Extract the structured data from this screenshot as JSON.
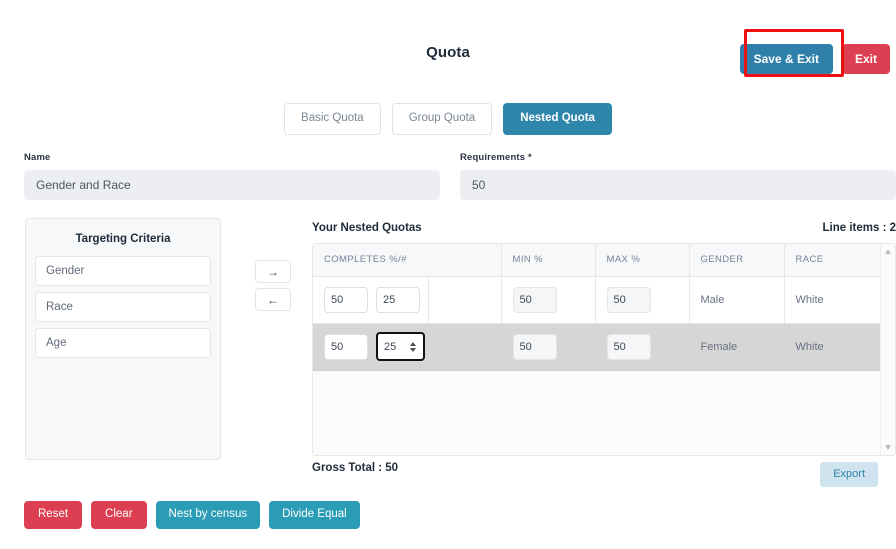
{
  "header": {
    "title": "Quota",
    "save_exit_label": "Save & Exit",
    "exit_label": "Exit",
    "annotation_color": "#ee1111"
  },
  "tabs": [
    {
      "label": "Basic Quota",
      "active": false
    },
    {
      "label": "Group Quota",
      "active": false
    },
    {
      "label": "Nested Quota",
      "active": true
    }
  ],
  "form": {
    "name_label": "Name",
    "name_value": "Gender and Race",
    "requirements_label": "Requirements *",
    "requirements_value": "50"
  },
  "criteria": {
    "title": "Targeting Criteria",
    "items": [
      {
        "label": "Gender"
      },
      {
        "label": "Race"
      },
      {
        "label": "Age"
      }
    ]
  },
  "transfer": {
    "right_label": "→",
    "left_label": "←"
  },
  "quotas": {
    "title": "Your Nested Quotas",
    "line_items_label": "Line items : 2",
    "columns": [
      "COMPLETES %/#",
      "MIN %",
      "MAX %",
      "GENDER",
      "RACE"
    ],
    "rows": [
      {
        "completes_pct": "50",
        "completes_num": "25",
        "min_pct": "50",
        "max_pct": "50",
        "gender": "Male",
        "race": "White",
        "selected": false
      },
      {
        "completes_pct": "50",
        "completes_num": "25",
        "min_pct": "50",
        "max_pct": "50",
        "gender": "Female",
        "race": "White",
        "selected": true
      }
    ],
    "gross_total_label": "Gross Total : 50",
    "export_label": "Export"
  },
  "bottom_actions": [
    {
      "label": "Reset",
      "style": "red"
    },
    {
      "label": "Clear",
      "style": "red"
    },
    {
      "label": "Nest by census",
      "style": "teal"
    },
    {
      "label": "Divide Equal",
      "style": "teal"
    }
  ],
  "colors": {
    "primary_blue": "#2e86ab",
    "danger_red": "#dc3f51",
    "teal": "#2a9cb5",
    "export_bg": "#cfe4ef",
    "selected_row": "#d6d6d6"
  }
}
